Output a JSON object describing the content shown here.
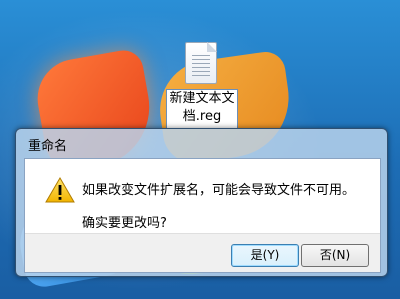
{
  "desktop": {
    "file_icon": "text-file-icon",
    "file_label_line1": "新建文本文",
    "file_label_line2": "档.reg"
  },
  "dialog": {
    "title": "重命名",
    "warning_icon": "warning-icon",
    "message": "如果改变文件扩展名，可能会导致文件不可用。",
    "question": "确实要更改吗?",
    "buttons": {
      "yes": "是(Y)",
      "no": "否(N)"
    }
  }
}
